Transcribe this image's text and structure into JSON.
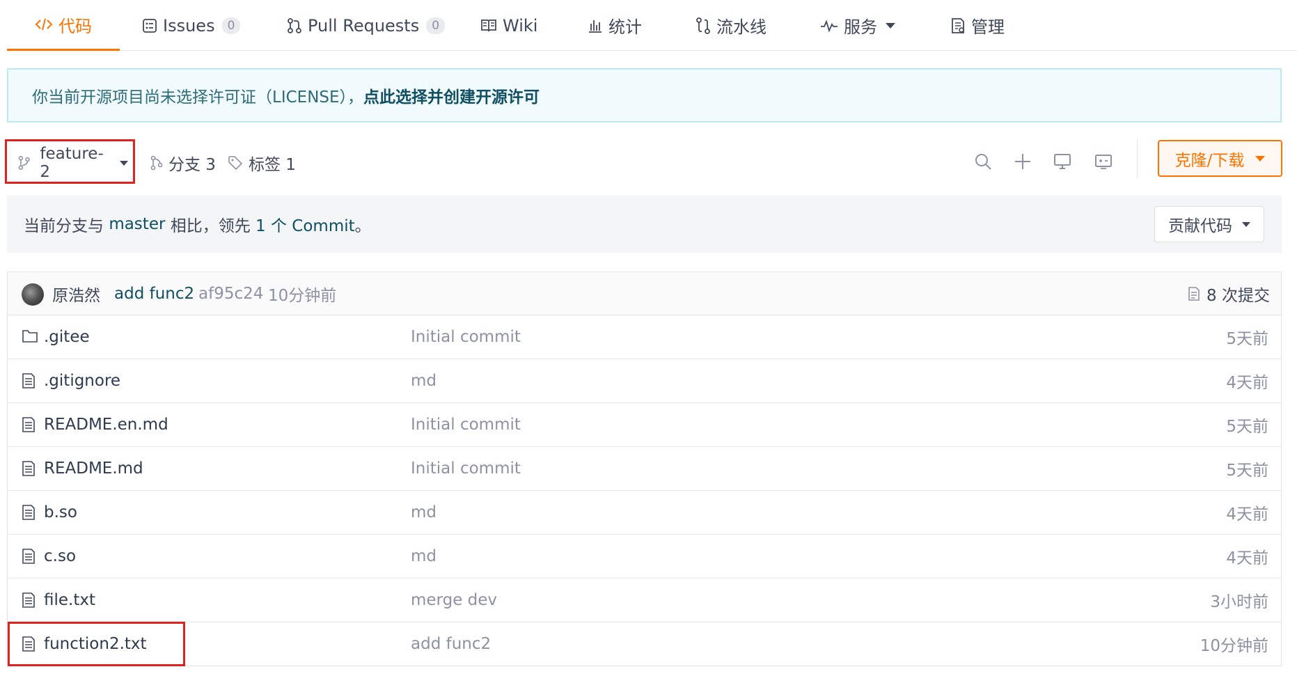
{
  "tabs": [
    {
      "label": "代码",
      "icon": "code-icon",
      "active": true
    },
    {
      "label": "Issues",
      "icon": "issues-icon",
      "count": "0"
    },
    {
      "label": "Pull Requests",
      "icon": "pull-request-icon",
      "count": "0"
    },
    {
      "label": "Wiki",
      "icon": "book-icon"
    },
    {
      "label": "统计",
      "icon": "bar-chart-icon"
    },
    {
      "label": "流水线",
      "icon": "pipeline-icon"
    },
    {
      "label": "服务",
      "icon": "pulse-icon"
    },
    {
      "label": "管理",
      "icon": "settings-doc-icon"
    }
  ],
  "license": {
    "text": "你当前开源项目尚未选择许可证（LICENSE），",
    "link": "点此选择并创建开源许可"
  },
  "branchbar": {
    "current_branch": "feature-2",
    "branches_label": "分支 3",
    "tags_label": "标签 1",
    "clone_label": "克隆/下载"
  },
  "compare": {
    "prefix": "当前分支与 ",
    "base": "master",
    "mid": " 相比，领先 ",
    "count": "1 个 Commit",
    "suffix": "。",
    "contribute_label": "贡献代码"
  },
  "latest_commit": {
    "author": "原浩然",
    "message": "add func2",
    "sha": "af95c24",
    "time": "10分钟前",
    "commits_label": "8 次提交"
  },
  "files": [
    {
      "name": ".gitee",
      "type": "folder",
      "message": "Initial commit",
      "time": "5天前"
    },
    {
      "name": ".gitignore",
      "type": "file",
      "message": "md",
      "time": "4天前"
    },
    {
      "name": "README.en.md",
      "type": "file",
      "message": "Initial commit",
      "time": "5天前"
    },
    {
      "name": "README.md",
      "type": "file",
      "message": "Initial commit",
      "time": "5天前"
    },
    {
      "name": "b.so",
      "type": "file",
      "message": "md",
      "time": "4天前"
    },
    {
      "name": "c.so",
      "type": "file",
      "message": "md",
      "time": "4天前"
    },
    {
      "name": "file.txt",
      "type": "file",
      "message": "merge dev",
      "time": "3小时前"
    },
    {
      "name": "function2.txt",
      "type": "file",
      "message": "add func2",
      "time": "10分钟前"
    }
  ],
  "colors": {
    "accent": "#fe7300",
    "highlight_box": "#e0211d",
    "link": "#0f4e63"
  }
}
